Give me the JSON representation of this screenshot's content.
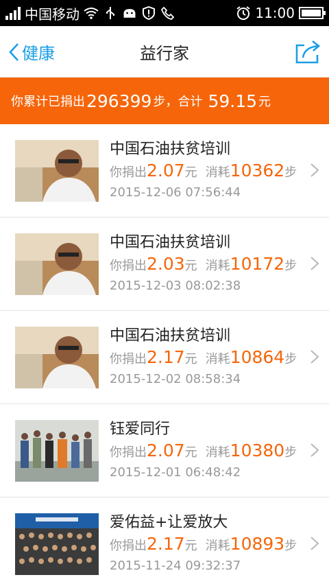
{
  "status_bar": {
    "carrier": "中国移动",
    "time": "11:00"
  },
  "nav": {
    "back_label": "健康",
    "title": "益行家"
  },
  "banner": {
    "prefix": "你累计已捐出",
    "steps": "296399",
    "steps_unit": "步，合计",
    "amount": "59.15",
    "amount_unit": "元"
  },
  "labels": {
    "donated": "你捐出",
    "yuan": "元",
    "consumed": "消耗",
    "steps": "步"
  },
  "items": [
    {
      "title": "中国石油扶贫培训",
      "amount": "2.07",
      "steps": "10362",
      "date": "2015-12-06 07:56:44",
      "thumb": "man-glasses-icon"
    },
    {
      "title": "中国石油扶贫培训",
      "amount": "2.03",
      "steps": "10172",
      "date": "2015-12-03 08:02:38",
      "thumb": "man-glasses-icon"
    },
    {
      "title": "中国石油扶贫培训",
      "amount": "2.17",
      "steps": "10864",
      "date": "2015-12-02 08:58:34",
      "thumb": "man-glasses-icon"
    },
    {
      "title": "钰爱同行",
      "amount": "2.07",
      "steps": "10380",
      "date": "2015-12-01 06:48:42",
      "thumb": "group-activity-icon"
    },
    {
      "title": "爱佑益+让爱放大",
      "amount": "2.17",
      "steps": "10893",
      "date": "2015-11-24 09:32:37",
      "thumb": "group-photo-icon"
    }
  ],
  "colors": {
    "accent_orange": "#f6650a",
    "link_blue": "#1a9ee6"
  }
}
